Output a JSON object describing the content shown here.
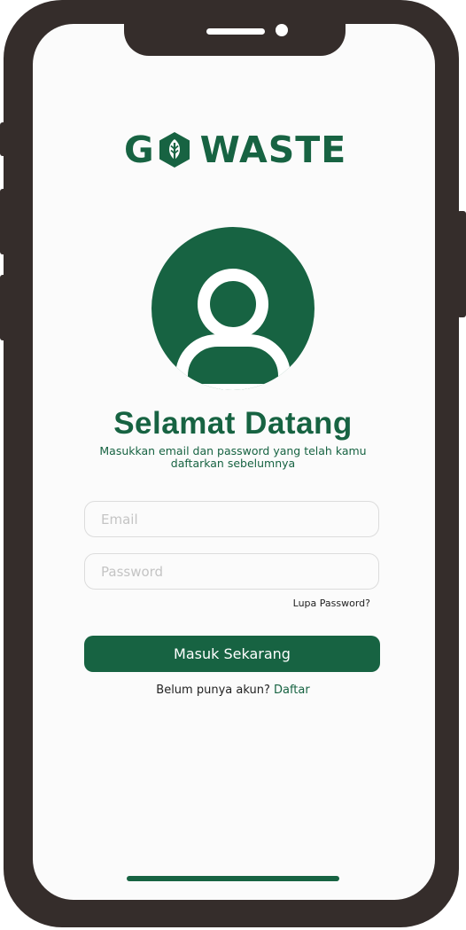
{
  "brand": {
    "logo_left": "G",
    "logo_right": "WASTE",
    "primary_color": "#176342",
    "logo_icon": "leaf-icon"
  },
  "welcome": {
    "title": "Selamat Datang",
    "subtitle": "Masukkan email dan password yang telah kamu daftarkan sebelumnya",
    "avatar_icon": "user-avatar-icon"
  },
  "form": {
    "email_placeholder": "Email",
    "email_value": "",
    "password_placeholder": "Password",
    "password_value": "",
    "forgot_label": "Lupa Password?",
    "submit_label": "Masuk Sekarang"
  },
  "register": {
    "prompt": "Belum punya akun?",
    "link_label": "Daftar"
  },
  "device": {
    "frame_color": "#352d2b"
  }
}
